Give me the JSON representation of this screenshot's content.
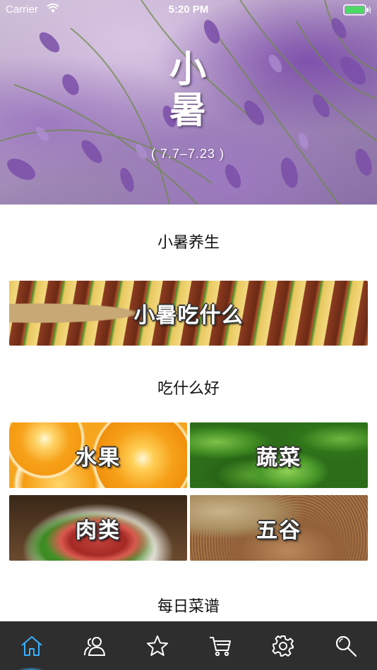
{
  "status_bar": {
    "carrier": "Carrier",
    "time": "5:20 PM",
    "battery_color": "#4cd964"
  },
  "hero": {
    "title": "小暑",
    "date_range": "( 7.7–7.23 )"
  },
  "sections": {
    "health_title": "小暑养生",
    "what_to_eat_title": "吃什么好",
    "daily_recipes_title": "每日菜谱"
  },
  "eat_banner": {
    "label": "小暑吃什么"
  },
  "food_tiles": [
    {
      "label": "水果"
    },
    {
      "label": "蔬菜"
    },
    {
      "label": "肉类"
    },
    {
      "label": "五谷"
    }
  ],
  "tabbar": {
    "active_color": "#3ab0ff",
    "icon_color": "#ffffff",
    "items": [
      {
        "icon": "home-icon",
        "active": true
      },
      {
        "icon": "users-icon",
        "active": false
      },
      {
        "icon": "star-icon",
        "active": false
      },
      {
        "icon": "cart-icon",
        "active": false
      },
      {
        "icon": "gear-icon",
        "active": false
      },
      {
        "icon": "search-icon",
        "active": false
      }
    ]
  }
}
